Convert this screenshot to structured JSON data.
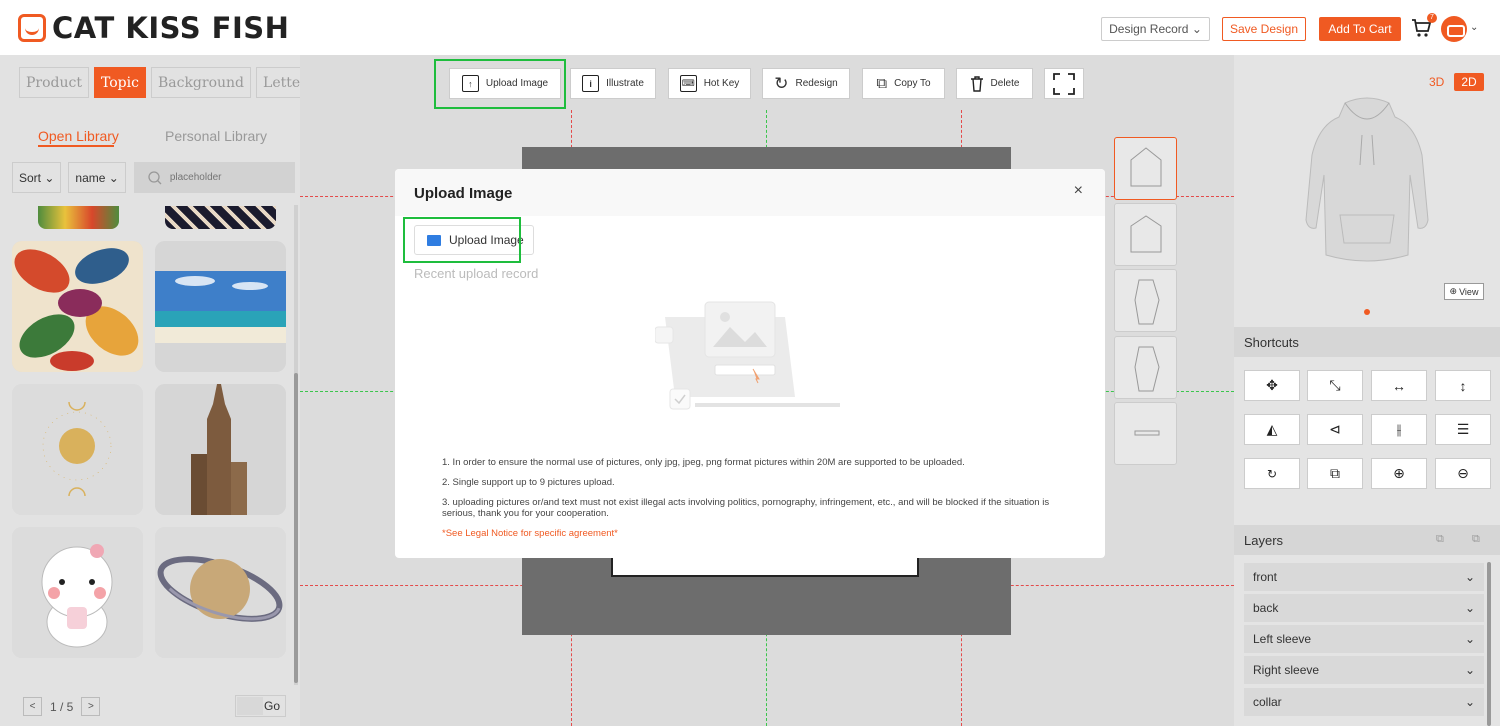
{
  "header": {
    "brand": "CAT KISS FISH",
    "design_record": "Design Record ⌄",
    "save_design": "Save Design",
    "add_to_cart": "Add To Cart",
    "cart_count": "7",
    "avatar_caret": "⌄"
  },
  "left_panel": {
    "tabs": [
      {
        "label": "Product",
        "active": false
      },
      {
        "label": "Topic",
        "active": true
      },
      {
        "label": "Background",
        "active": false
      },
      {
        "label": "Letter",
        "active": false
      }
    ],
    "library_tabs": {
      "open": "Open Library",
      "personal": "Personal Library"
    },
    "sort_label": "Sort ⌄",
    "name_label": "name ⌄",
    "search_placeholder": "placeholder",
    "pager": {
      "prev": "<",
      "next": ">",
      "page_text": "1 / 5",
      "go": "Go"
    }
  },
  "toolbar": {
    "upload": "Upload Image",
    "illustrate": "Illustrate",
    "hotkey": "Hot Key",
    "redesign": "Redesign",
    "copy_to": "Copy To",
    "delete": "Delete"
  },
  "modal": {
    "title": "Upload Image",
    "close": "×",
    "upload_button": "Upload Image",
    "recent": "Recent upload record",
    "note1": "1. In order to ensure the normal use of pictures, only jpg, jpeg, png format pictures within 20M are supported to be uploaded.",
    "note2": "2. Single support up to 9 pictures upload.",
    "note3": "3. uploading pictures or/and text must not exist illegal acts involving politics, pornography, infringement, etc., and will be blocked if the situation is serious, thank you for your cooperation.",
    "legal": "*See Legal Notice for specific agreement*"
  },
  "right_panel": {
    "d3": "3D",
    "d2": "2D",
    "view_label": "View",
    "shortcuts_title": "Shortcuts",
    "layers_title": "Layers",
    "layers": [
      "front",
      "back",
      "Left sleeve",
      "Right sleeve",
      "collar"
    ]
  },
  "colors": {
    "accent": "#f05a22",
    "highlight": "#1ebd3d"
  }
}
